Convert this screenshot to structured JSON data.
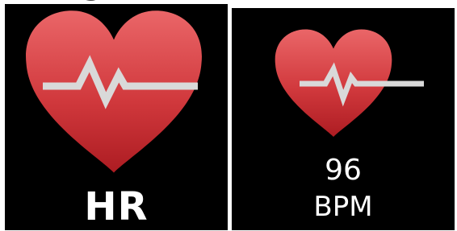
{
  "heading_fragment": "g",
  "panels": {
    "left": {
      "label": "HR"
    },
    "right": {
      "value": "96",
      "unit": "BPM"
    }
  },
  "icons": {
    "left": "heart-pulse-icon",
    "right": "heart-pulse-icon"
  },
  "colors": {
    "background": "#000000",
    "heart_light": "#e6595c",
    "heart_dark": "#b21e24",
    "pulse_line": "#d9d9d9",
    "text": "#ffffff"
  }
}
